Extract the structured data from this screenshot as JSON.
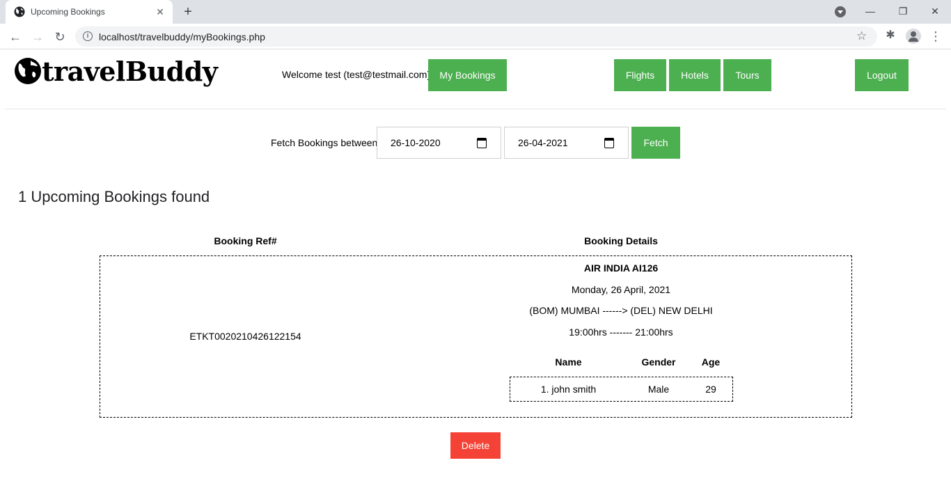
{
  "browser": {
    "tab_title": "Upcoming Bookings",
    "url": "localhost/travelbuddy/myBookings.php"
  },
  "header": {
    "logo_text": "travelBuddy",
    "welcome": "Welcome test (test@testmail.com)",
    "my_bookings": "My Bookings",
    "flights": "Flights",
    "hotels": "Hotels",
    "tours": "Tours",
    "logout": "Logout"
  },
  "fetch": {
    "label": "Fetch Bookings between",
    "from_date": "26-10-2020",
    "to_date": "26-04-2021",
    "button": "Fetch"
  },
  "summary": "1 Upcoming Bookings found",
  "table": {
    "headers": [
      "Booking Ref#",
      "Booking Details"
    ],
    "booking": {
      "ref": "ETKT0020210426122154",
      "flight": "AIR INDIA AI126",
      "date": "Monday, 26 April, 2021",
      "route": "(BOM) MUMBAI ------> (DEL) NEW DELHI",
      "time": "19:00hrs ------- 21:00hrs",
      "passenger_headers": [
        "Name",
        "Gender",
        "Age"
      ],
      "passengers": [
        {
          "name": "1. john smith",
          "gender": "Male",
          "age": "29"
        }
      ]
    }
  },
  "delete_button": "Delete",
  "colors": {
    "primary_button": "#4caf50",
    "danger_button": "#f44336"
  }
}
